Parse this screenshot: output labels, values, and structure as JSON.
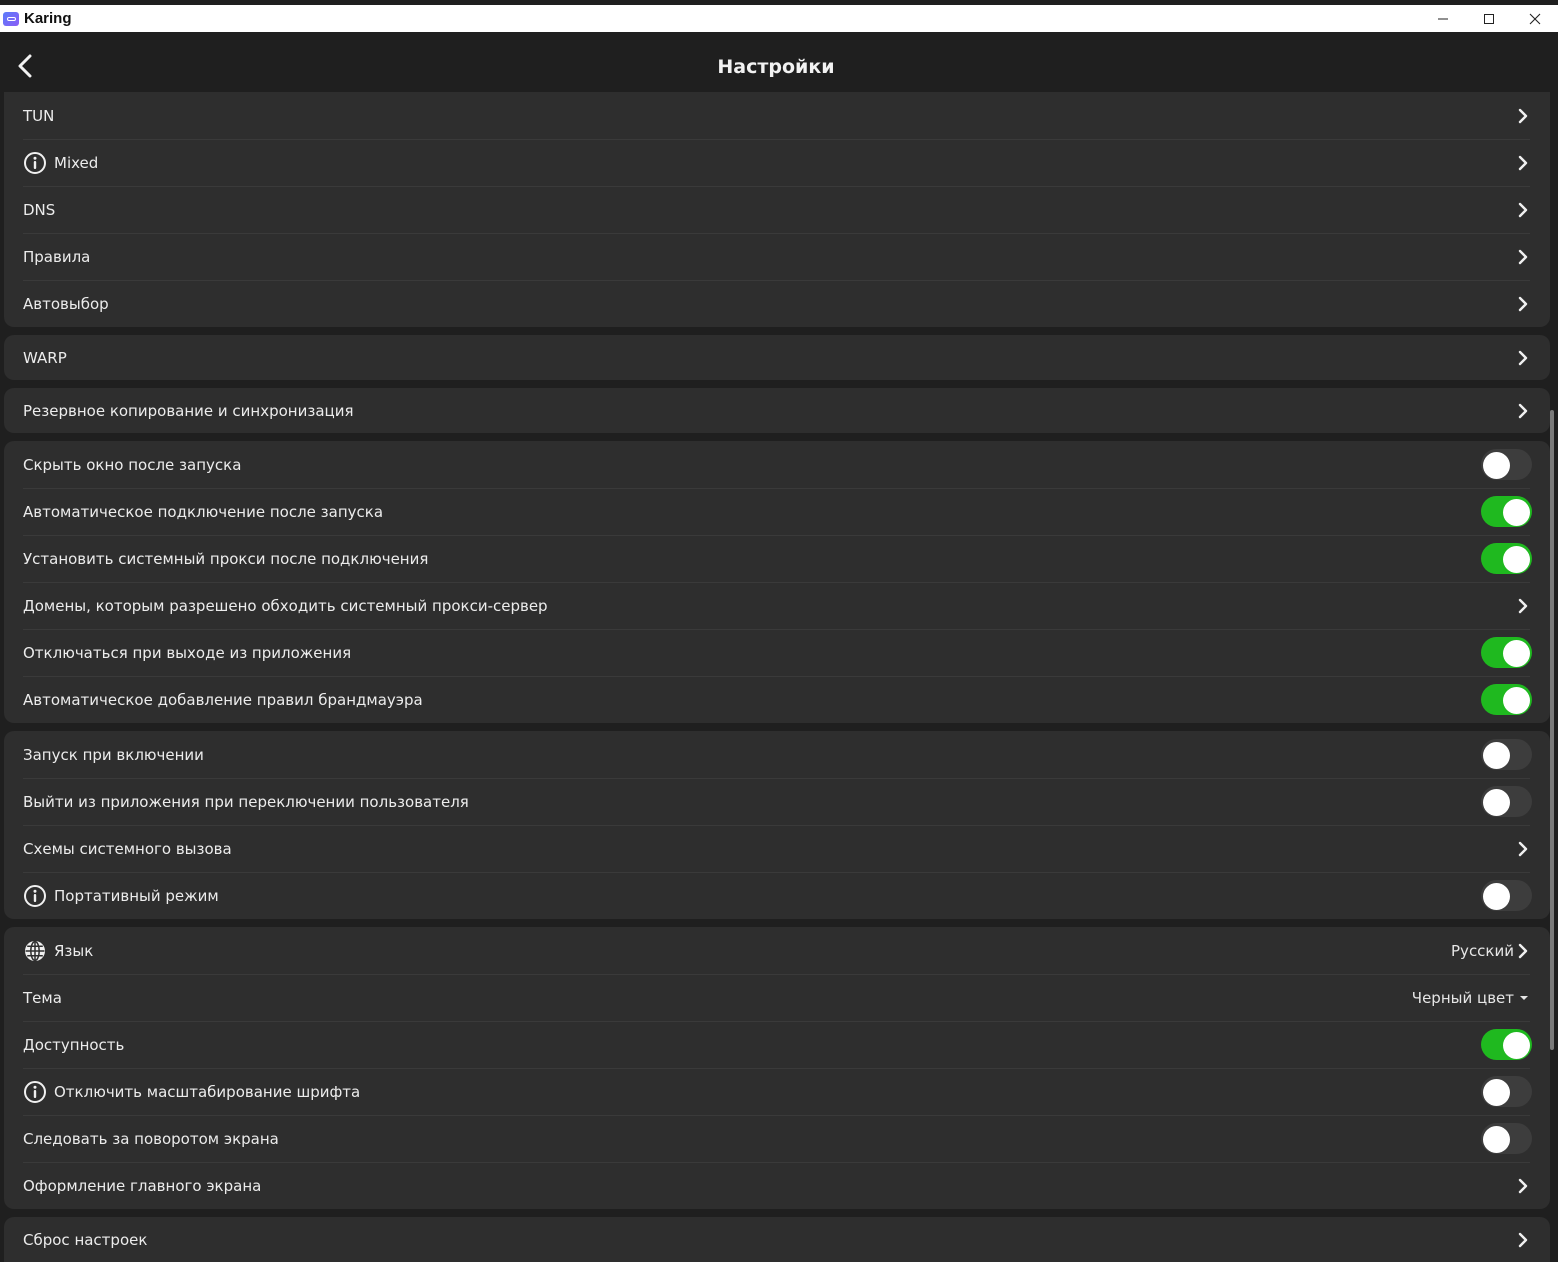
{
  "window": {
    "title": "Karing"
  },
  "header": {
    "title": "Настройки"
  },
  "groups": [
    {
      "rows": [
        {
          "label": "TUN",
          "control": "chevron"
        },
        {
          "label": "Mixed",
          "control": "chevron",
          "icon": "info-icon"
        },
        {
          "label": "DNS",
          "control": "chevron"
        },
        {
          "label": "Правила",
          "control": "chevron"
        },
        {
          "label": "Автовыбор",
          "control": "chevron"
        }
      ]
    },
    {
      "rows": [
        {
          "label": "WARP",
          "control": "chevron"
        }
      ]
    },
    {
      "rows": [
        {
          "label": "Резервное копирование и синхронизация",
          "control": "chevron"
        }
      ]
    },
    {
      "rows": [
        {
          "label": "Скрыть окно после запуска",
          "control": "toggle",
          "on": false
        },
        {
          "label": "Автоматическое подключение после запуска",
          "control": "toggle",
          "on": true
        },
        {
          "label": "Установить системный прокси после подключения",
          "control": "toggle",
          "on": true
        },
        {
          "label": "Домены, которым разрешено обходить системный прокси-сервер",
          "control": "chevron"
        },
        {
          "label": "Отключаться при выходе из приложения",
          "control": "toggle",
          "on": true
        },
        {
          "label": "Автоматическое добавление правил брандмауэра",
          "control": "toggle",
          "on": true
        }
      ]
    },
    {
      "rows": [
        {
          "label": "Запуск при включении",
          "control": "toggle",
          "on": false
        },
        {
          "label": "Выйти из приложения при переключении пользователя",
          "control": "toggle",
          "on": false
        },
        {
          "label": "Схемы системного вызова",
          "control": "chevron"
        },
        {
          "label": "Портативный режим",
          "control": "toggle",
          "on": false,
          "icon": "info-icon"
        }
      ]
    },
    {
      "rows": [
        {
          "label": "Язык",
          "control": "value-chevron",
          "value": "Русский",
          "icon": "globe-icon"
        },
        {
          "label": "Тема",
          "control": "dropdown",
          "value": "Черный цвет"
        },
        {
          "label": "Доступность",
          "control": "toggle",
          "on": true
        },
        {
          "label": "Отключить масштабирование шрифта",
          "control": "toggle",
          "on": false,
          "icon": "info-icon"
        },
        {
          "label": "Следовать за поворотом экрана",
          "control": "toggle",
          "on": false
        },
        {
          "label": "Оформление главного экрана",
          "control": "chevron"
        }
      ]
    },
    {
      "rows": [
        {
          "label": "Сброс настроек",
          "control": "chevron"
        }
      ]
    }
  ],
  "colors": {
    "toggle_on": "#1fb91f",
    "toggle_off": "#3d3d3d",
    "group_bg": "#2e2e2e",
    "page_bg": "#1f1f1f"
  }
}
